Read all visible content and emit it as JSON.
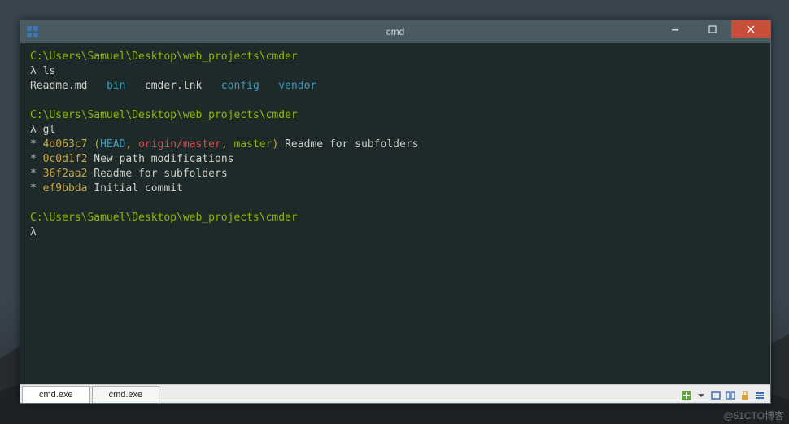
{
  "window": {
    "title": "cmd"
  },
  "terminal": {
    "prompts": [
      {
        "path": "C:\\Users\\Samuel\\Desktop\\web_projects\\cmder",
        "lambda": "λ",
        "cmd": "ls"
      },
      {
        "path": "C:\\Users\\Samuel\\Desktop\\web_projects\\cmder",
        "lambda": "λ",
        "cmd": "gl"
      },
      {
        "path": "C:\\Users\\Samuel\\Desktop\\web_projects\\cmder",
        "lambda": "λ",
        "cmd": ""
      }
    ],
    "ls_output": {
      "readme": "Readme.md",
      "bin": "bin",
      "cmderlnk": "cmder.lnk",
      "config": "config",
      "vendor": "vendor"
    },
    "gl": {
      "row0": {
        "star": "*",
        "hash": "4d063c7",
        "p_open": "(",
        "head": "HEAD",
        "comma1": ", ",
        "origin": "origin/master",
        "comma2": ", ",
        "master": "master",
        "p_close": ")",
        "msg": " Readme for subfolders"
      },
      "row1": {
        "star": "*",
        "hash": "0c0d1f2",
        "msg": " New path modifications"
      },
      "row2": {
        "star": "*",
        "hash": "36f2aa2",
        "msg": " Readme for subfolders"
      },
      "row3": {
        "star": "*",
        "hash": "ef9bbda",
        "msg": " Initial commit"
      }
    }
  },
  "statusbar": {
    "tabs": [
      "cmd.exe",
      "cmd.exe"
    ]
  },
  "watermark": "@51CTO博客"
}
